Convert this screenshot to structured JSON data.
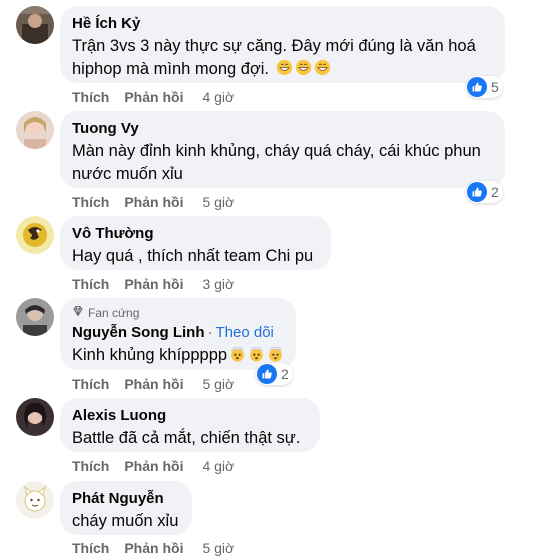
{
  "comments": [
    {
      "name": "Hề Ích Kỷ",
      "text_lines": [
        "Trận 3vs 3 này thực sự căng. Đây mới đúng là văn hoá",
        "hiphop mà mình mong đợi."
      ],
      "emojis": [
        "grinning-face",
        "grinning-face",
        "grinning-face"
      ],
      "like_label": "Thích",
      "reply_label": "Phản hồi",
      "time": "4 giờ",
      "reactions": "5"
    },
    {
      "name": "Tuong Vy",
      "text_lines": [
        "Màn này đỉnh kinh khủng, cháy quá cháy, cái khúc phun",
        "nước muốn xỉu"
      ],
      "like_label": "Thích",
      "reply_label": "Phản hồi",
      "time": "5 giờ",
      "reactions": "2"
    },
    {
      "name": "Vô Thường",
      "text_lines": [
        "Hay quá , thích nhất team Chi pu"
      ],
      "like_label": "Thích",
      "reply_label": "Phản hồi",
      "time": "3 giờ"
    },
    {
      "badge": "Fan cứng",
      "name": "Nguyễn Song Linh",
      "follow": "Theo dõi",
      "separator": "·",
      "text_lines": [
        "Kinh khủng khíppppp"
      ],
      "emojis": [
        "exploding-head",
        "exploding-head",
        "exploding-head"
      ],
      "like_label": "Thích",
      "reply_label": "Phản hồi",
      "time": "5 giờ",
      "reactions": "2"
    },
    {
      "name": "Alexis Luong",
      "text_lines": [
        "Battle đã cả mắt, chiến thật sự."
      ],
      "like_label": "Thích",
      "reply_label": "Phản hồi",
      "time": "4 giờ"
    },
    {
      "name": "Phát Nguyễn",
      "text_lines": [
        "cháy muốn xỉu"
      ],
      "like_label": "Thích",
      "reply_label": "Phản hồi",
      "time": "5 giờ"
    }
  ],
  "colors": {
    "bubble": "#f0f2f5",
    "meta": "#65676b",
    "link": "#216fdb",
    "like_blue": "#1877f2"
  }
}
